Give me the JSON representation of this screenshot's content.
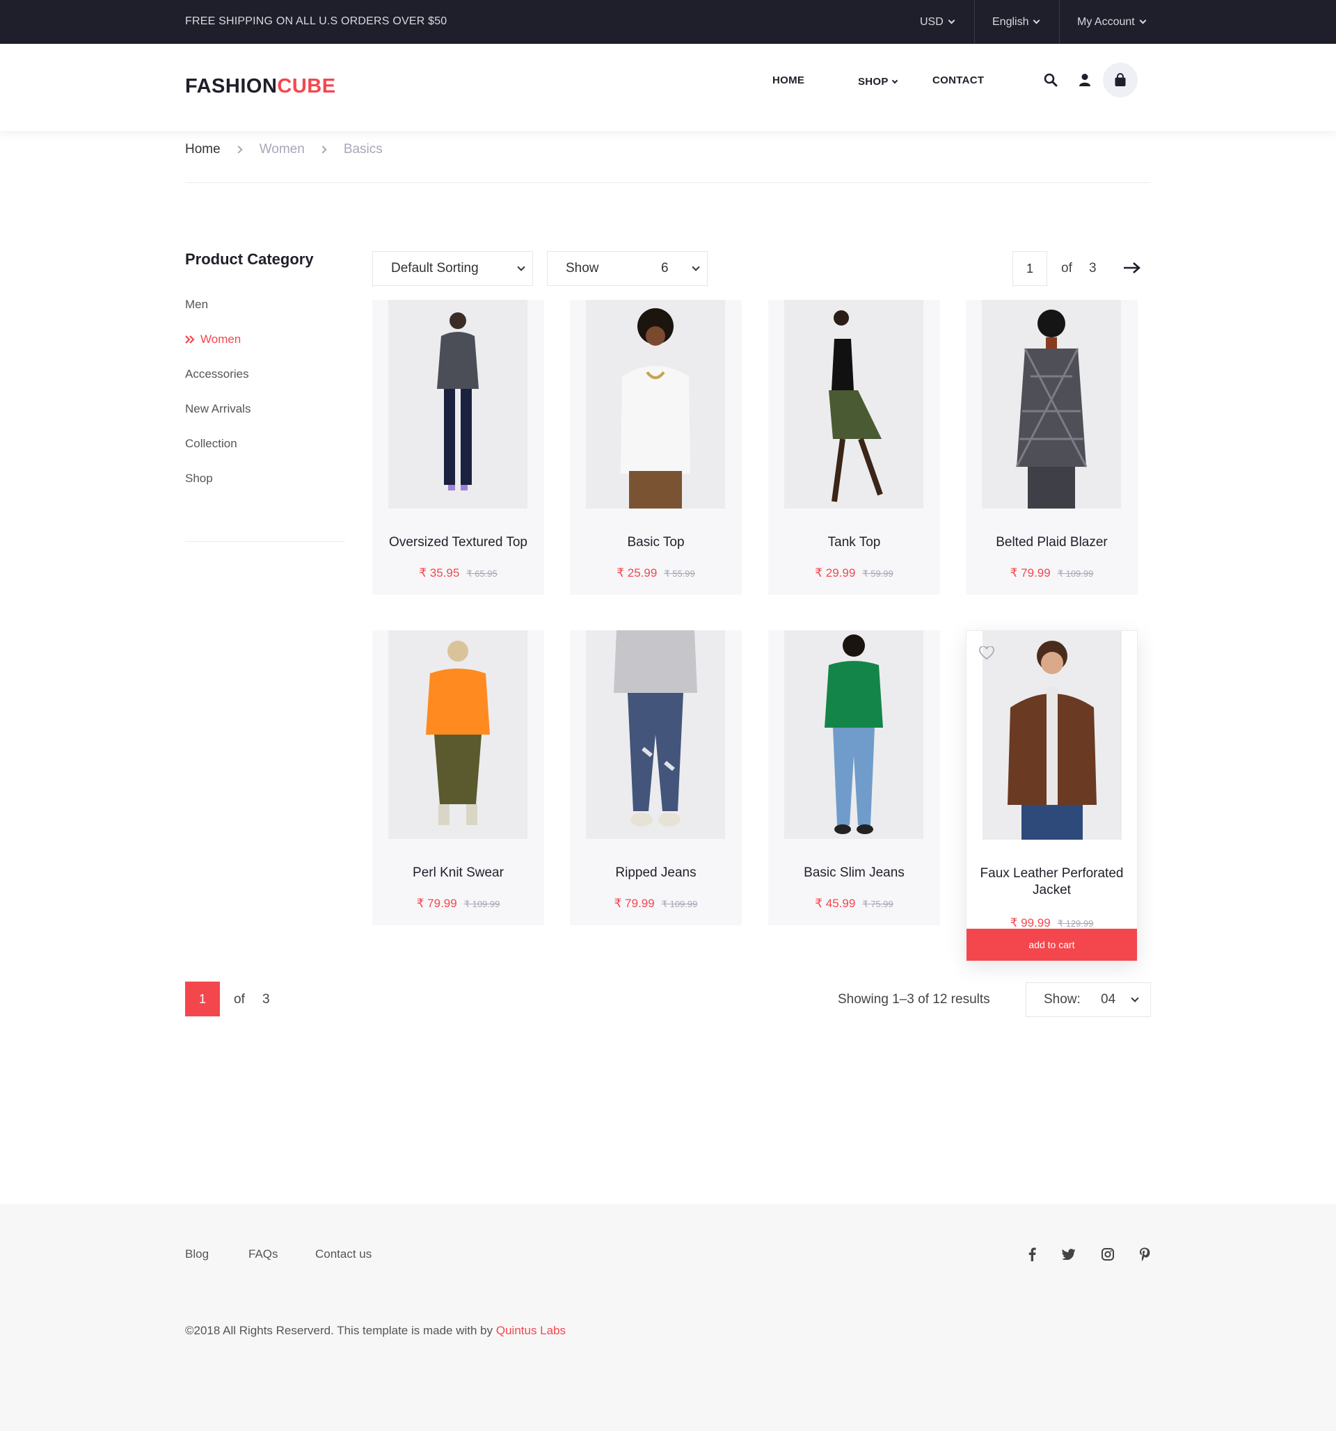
{
  "topbar": {
    "shipping": "FREE SHIPPING ON ALL U.S ORDERS OVER $50",
    "currency": "USD",
    "language": "English",
    "account": "My Account"
  },
  "header": {
    "logo_a": "FASHION",
    "logo_b": "CUBE",
    "nav": {
      "home": "HOME",
      "shop": "SHOP",
      "contact": "CONTACT"
    }
  },
  "breadcrumb": [
    "Home",
    "Women",
    "Basics"
  ],
  "sidebar": {
    "title": "Product Category",
    "items": [
      "Men",
      "Women",
      "Accessories",
      "New Arrivals",
      "Collection",
      "Shop"
    ],
    "active": "Women"
  },
  "toolbar": {
    "sorting": "Default Sorting",
    "show_label": "Show",
    "show_value": "6",
    "page_current": "1",
    "page_of": "of",
    "page_total": "3"
  },
  "products": [
    {
      "name": "Oversized Textured Top",
      "price": "₹ 35.95",
      "old": "₹ 65.95"
    },
    {
      "name": "Basic Top",
      "price": "₹ 25.99",
      "old": "₹ 55.99"
    },
    {
      "name": "Tank Top",
      "price": "₹ 29.99",
      "old": "₹ 59.99"
    },
    {
      "name": "Belted Plaid Blazer",
      "price": "₹ 79.99",
      "old": "₹ 109.99"
    },
    {
      "name": "Perl Knit Swear",
      "price": "₹ 79.99",
      "old": "₹ 109.99"
    },
    {
      "name": "Ripped Jeans",
      "price": "₹ 79.99",
      "old": "₹ 109.99"
    },
    {
      "name": "Basic Slim Jeans",
      "price": "₹ 45.99",
      "old": "₹ 75.99"
    },
    {
      "name": "Faux Leather Perforated Jacket",
      "price": "₹ 99.99",
      "old": "₹ 129.99",
      "cta": "add to cart"
    }
  ],
  "pagination": {
    "current": "1",
    "of": "of",
    "total": "3",
    "results": "Showing 1–3 of 12 results",
    "show_label": "Show:",
    "show_value": "04"
  },
  "footer": {
    "links": [
      "Blog",
      "FAQs",
      "Contact us"
    ],
    "copyright": "©2018 All Rights Reserverd. This template is made with  by ",
    "credit": "Quintus Labs",
    "social": [
      "facebook-icon",
      "twitter-icon",
      "instagram-icon",
      "pinterest-icon"
    ]
  },
  "colors": {
    "accent": "#f4474d",
    "dark": "#1f1f2b",
    "muted": "#a6a7b6"
  }
}
